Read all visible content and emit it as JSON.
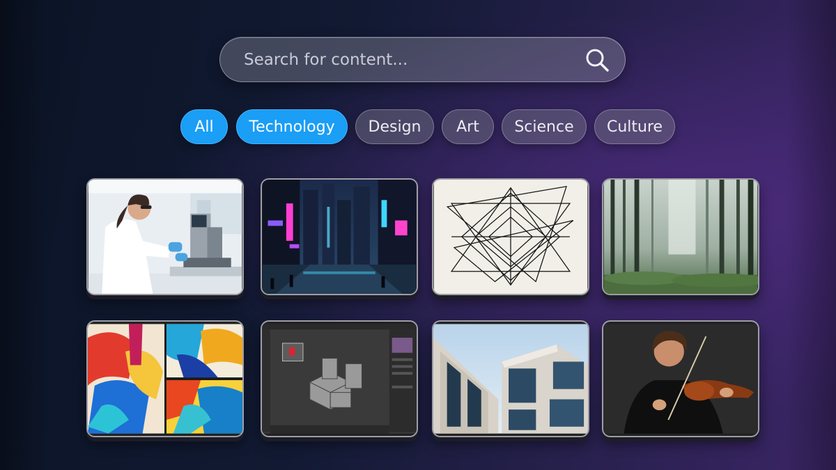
{
  "search": {
    "placeholder": "Search for content..."
  },
  "filters": [
    {
      "label": "All",
      "active": true
    },
    {
      "label": "Technology",
      "active": true
    },
    {
      "label": "Design",
      "active": false
    },
    {
      "label": "Art",
      "active": false
    },
    {
      "label": "Science",
      "active": false
    },
    {
      "label": "Culture",
      "active": false
    }
  ],
  "colors": {
    "accent": "#1a9ef6",
    "background_dark": "#0b1426",
    "background_purple": "#3b2566"
  },
  "cards": [
    {
      "icon": "scientist-lab-image"
    },
    {
      "icon": "neon-city-image"
    },
    {
      "icon": "geometric-lines-image"
    },
    {
      "icon": "misty-forest-image"
    },
    {
      "icon": "abstract-painting-image"
    },
    {
      "icon": "3d-modeling-software-image"
    },
    {
      "icon": "modern-architecture-image"
    },
    {
      "icon": "violinist-image"
    }
  ]
}
